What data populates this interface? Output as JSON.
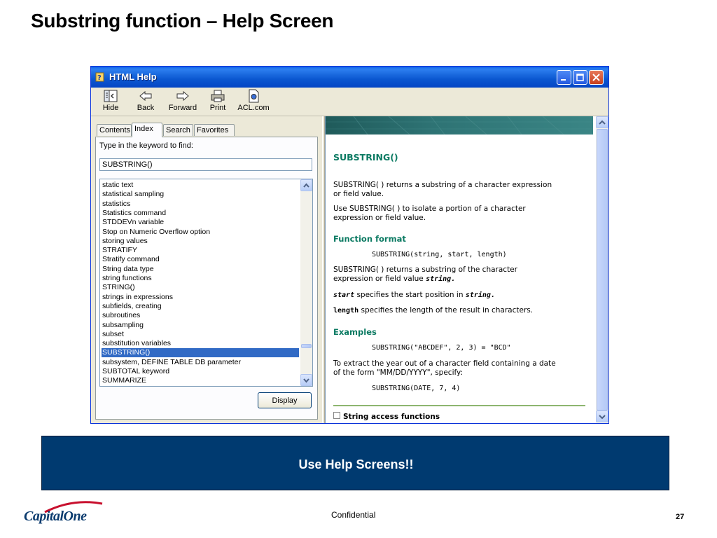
{
  "slide": {
    "title": "Substring function – Help Screen",
    "cta": "Use Help Screens!!",
    "confidential": "Confidential",
    "page_number": "27",
    "logo": "CapitalOne"
  },
  "window": {
    "title": "HTML Help",
    "toolbar": [
      {
        "label": "Hide",
        "icon": "hide-icon"
      },
      {
        "label": "Back",
        "icon": "back-arrow-icon"
      },
      {
        "label": "Forward",
        "icon": "forward-arrow-icon"
      },
      {
        "label": "Print",
        "icon": "printer-icon"
      },
      {
        "label": "ACL.com",
        "icon": "web-page-icon"
      }
    ]
  },
  "left_pane": {
    "tabs": [
      "Contents",
      "Index",
      "Search",
      "Favorites"
    ],
    "active_tab": "Index",
    "keyword_label": "Type in the keyword to find:",
    "keyword_value": "SUBSTRING()",
    "index_items": [
      "static text",
      "statistical sampling",
      "statistics",
      "Statistics command",
      "STDDEVn variable",
      "Stop on Numeric Overflow option",
      "storing values",
      "STRATIFY",
      "Stratify command",
      "String data type",
      "string functions",
      "STRING()",
      "strings in expressions",
      "subfields, creating",
      "subroutines",
      "subsampling",
      "subset",
      "substitution variables",
      "SUBSTRING()",
      "subsystem, DEFINE TABLE DB parameter",
      "SUBTOTAL keyword",
      "SUMMARIZE"
    ],
    "selected_item": "SUBSTRING()",
    "display_button": "Display"
  },
  "right_pane": {
    "heading": "SUBSTRING()",
    "intro_1": "SUBSTRING( ) returns a substring of a character expression",
    "intro_2": "or field value.",
    "use_1": "Use SUBSTRING( ) to isolate a portion of a character",
    "use_2": "expression or field value.",
    "format_heading": "Function format",
    "format_code": "SUBSTRING(string, start, length)",
    "returns_1": "SUBSTRING( ) returns a substring of the character",
    "returns_2": "expression or field value",
    "returns_2_code": "string.",
    "start_code": "start",
    "start_text": "specifies the start position in",
    "start_text_code": "string.",
    "length_code": "length",
    "length_text": "specifies the length of the result in characters.",
    "examples_heading": "Examples",
    "example_1": "SUBSTRING(\"ABCDEF\", 2, 3) = \"BCD\"",
    "extract_1": "To extract the year out of a character field containing a date",
    "extract_2": "of the form \"MM/DD/YYYY\", specify:",
    "example_2": "SUBSTRING(DATE, 7, 4)",
    "related": "String access functions"
  },
  "colors": {
    "titlebar": "#0b57d0",
    "cta_background": "#003a70",
    "heading_green": "#0b7a62",
    "selection": "#316ac5"
  }
}
